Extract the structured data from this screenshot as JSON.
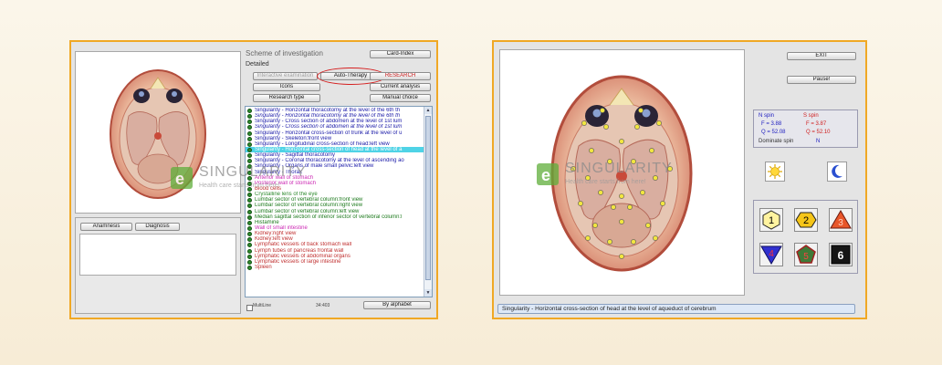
{
  "left_window": {
    "title": "Scheme of investigation",
    "subtitle": "Detailed",
    "buttons": {
      "card_index": "Card-Index",
      "interactive_examination": "Interactive examination",
      "auto_therapy": "Auto-Therapy",
      "research": "RESEARCH",
      "icons": "Icons",
      "current_analysis": "Current analysis",
      "research_type": "Research type",
      "manual_choice": "Manual choice",
      "anamnesis": "Anamnesis",
      "diagnosis": "Diagnosis",
      "by_alphabet": "By alphabet"
    },
    "bottom": {
      "multiline": "MultiLine",
      "count": "34:403"
    },
    "list_items": [
      {
        "text": "Singularity - Horizontal thoracotomy at the level of the 6th th",
        "color": "#1a1aa8",
        "italic": false,
        "selected": false
      },
      {
        "text": "Singularity - Horizontal thoracotomy at the level of the 6th th",
        "color": "#1a1aa8",
        "italic": true,
        "selected": false
      },
      {
        "text": "Singularity - Cross section of abdomen at the level of 1st lum",
        "color": "#1a1aa8",
        "italic": false,
        "selected": false
      },
      {
        "text": "Singularity - Cross section of abdomen at the level of 1st lum",
        "color": "#1a1aa8",
        "italic": true,
        "selected": false
      },
      {
        "text": "Singularity - Horizontal cross-section of trunk at the level of u",
        "color": "#1a1aa8",
        "italic": false,
        "selected": false
      },
      {
        "text": "Singularity - Skeleton:front view",
        "color": "#1a1aa8",
        "italic": false,
        "selected": false
      },
      {
        "text": "Singularity - Longitudinal cross-section of head:left view",
        "color": "#1a1aa8",
        "italic": false,
        "selected": false
      },
      {
        "text": "Singularity - Horizontal cross-section of head at the level of a",
        "color": "#ffffff",
        "italic": false,
        "selected": true
      },
      {
        "text": "Singularity - Sagittal thoracotomy",
        "color": "#1a1aa8",
        "italic": false,
        "selected": false
      },
      {
        "text": "Singularity - Coronal thoracotomy at the level of ascending ao",
        "color": "#1a1aa8",
        "italic": false,
        "selected": false
      },
      {
        "text": "Singularity - Organs of male small pelvic:left view",
        "color": "#1a1aa8",
        "italic": false,
        "selected": false
      },
      {
        "text": "Singularity - Thorax",
        "color": "#1a1aa8",
        "italic": false,
        "selected": false
      },
      {
        "text": "Anterior wall of stomach",
        "color": "#cc2ab4",
        "italic": false,
        "selected": false
      },
      {
        "text": "Posterior wall of stomach",
        "color": "#cc2ab4",
        "italic": false,
        "selected": false
      },
      {
        "text": "Blood cells",
        "color": "#c03030",
        "italic": false,
        "selected": false
      },
      {
        "text": "Crystalline lens of the eye",
        "color": "#2e8b2e",
        "italic": false,
        "selected": false
      },
      {
        "text": "Lumbar sector of vertebral column:front view",
        "color": "#1d7a1d",
        "italic": false,
        "selected": false
      },
      {
        "text": "Lumbar sector of vertebral column:right view",
        "color": "#1d7a1d",
        "italic": false,
        "selected": false
      },
      {
        "text": "Lumbar sector of vertebral column:left view",
        "color": "#1d7a1d",
        "italic": false,
        "selected": false
      },
      {
        "text": "Median sagittal section of inferior sector of vertebral column:l",
        "color": "#1d7a1d",
        "italic": false,
        "selected": false
      },
      {
        "text": "Histamine",
        "color": "#1d7a1d",
        "italic": false,
        "selected": false
      },
      {
        "text": "Wall of small intestine",
        "color": "#cc2ab4",
        "italic": false,
        "selected": false
      },
      {
        "text": "Kidney:right view",
        "color": "#c03030",
        "italic": false,
        "selected": false
      },
      {
        "text": "Kidney:left view",
        "color": "#c03030",
        "italic": false,
        "selected": false
      },
      {
        "text": "Lymphatic vessels of back stomach wall",
        "color": "#c03030",
        "italic": false,
        "selected": false
      },
      {
        "text": "Lymph tubes of pancreas frontal wall",
        "color": "#c03030",
        "italic": false,
        "selected": false
      },
      {
        "text": "Lymphatic vessels of abdominal organs",
        "color": "#c03030",
        "italic": false,
        "selected": false
      },
      {
        "text": "Lymphatic vessels of large intestine",
        "color": "#c03030",
        "italic": false,
        "selected": false
      },
      {
        "text": "Spleen",
        "color": "#c03030",
        "italic": false,
        "selected": false
      }
    ]
  },
  "right_window": {
    "buttons": {
      "exit": "EXIT",
      "pause": "Pause!"
    },
    "spin": {
      "n_label": "N spin",
      "s_label": "S spin",
      "n_f": "F = 3.88",
      "s_f": "F = 3.87",
      "n_q": "Q = 52.08",
      "s_q": "Q = 52.10",
      "dominate_label": "Dominate spin",
      "dominate_value": "N"
    },
    "number_buttons": [
      "1",
      "2",
      "3",
      "4",
      "5",
      "6"
    ],
    "status": "Singularity - Horizontal cross-section of head at the level of aqueduct of cerebrum"
  },
  "watermark": {
    "brand": "SINGULARITY",
    "tagline": "Health care starts from here!"
  },
  "colors": {
    "panel_border": "#f0a825",
    "selection": "#4fd3e6",
    "accent_red": "#d52020"
  },
  "icons": {
    "sun": "sun-icon",
    "moon": "moon-icon"
  }
}
